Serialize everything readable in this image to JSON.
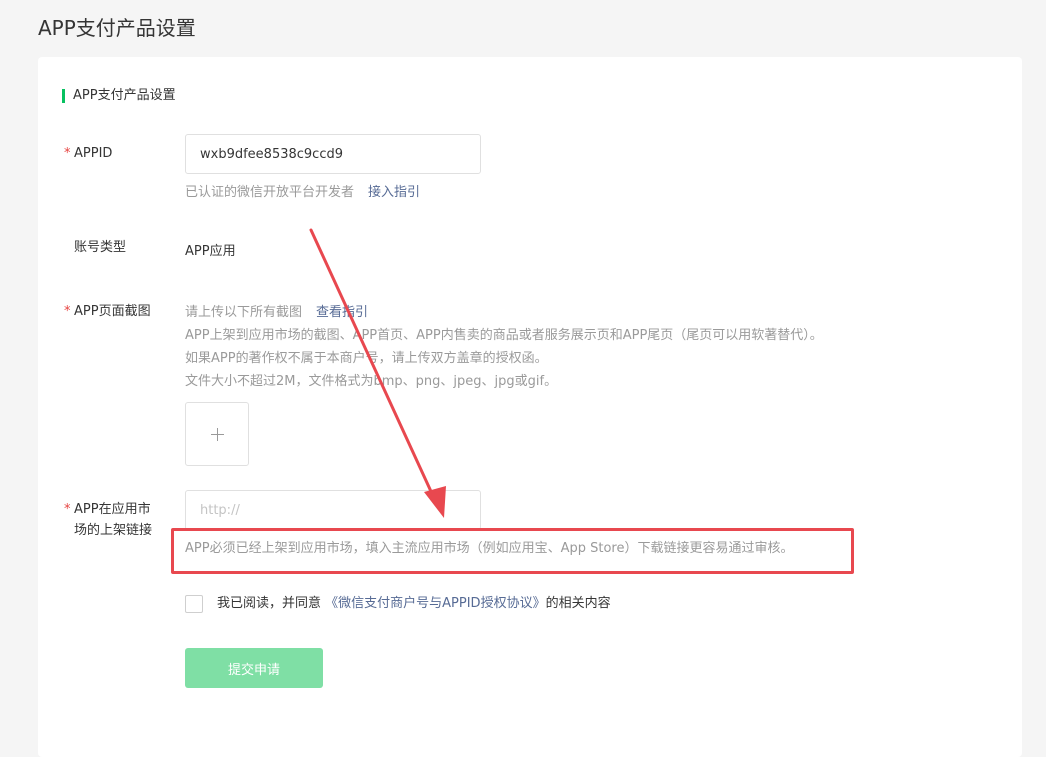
{
  "page": {
    "title": "APP支付产品设置"
  },
  "section": {
    "title": "APP支付产品设置"
  },
  "appid": {
    "label": "APPID",
    "required_mark": "*",
    "value": "wxb9dfee8538c9ccd9",
    "hint": "已认证的微信开放平台开发者",
    "hint_link": "接入指引"
  },
  "account_type": {
    "label": "账号类型",
    "value": "APP应用"
  },
  "screenshot": {
    "label": "APP页面截图",
    "required_mark": "*",
    "hint_line1": "请上传以下所有截图",
    "hint_link": "查看指引",
    "hint_line2": "APP上架到应用市场的截图、APP首页、APP内售卖的商品或者服务展示页和APP尾页（尾页可以用软著替代）。",
    "hint_line3": "如果APP的著作权不属于本商户号，请上传双方盖章的授权函。",
    "hint_line4": "文件大小不超过2M，文件格式为bmp、png、jpeg、jpg或gif。"
  },
  "market_link": {
    "label_line1": "APP在应用市",
    "label_line2": "场的上架链接",
    "required_mark": "*",
    "placeholder": "http://",
    "hint": "APP必须已经上架到应用市场，填入主流应用市场（例如应用宝、App Store）下载链接更容易通过审核。"
  },
  "agreement": {
    "prefix": "我已阅读，并同意",
    "link": "《微信支付商户号与APPID授权协议》",
    "suffix": "的相关内容"
  },
  "submit": {
    "label": "提交申请"
  },
  "colors": {
    "accent": "#07c160",
    "button_disabled": "#7fdfa5",
    "link": "#576b95",
    "annotation": "#e8484f",
    "required": "#e64340"
  },
  "icons": {
    "upload": "plus-icon",
    "annotation_arrow": "arrow-icon"
  }
}
